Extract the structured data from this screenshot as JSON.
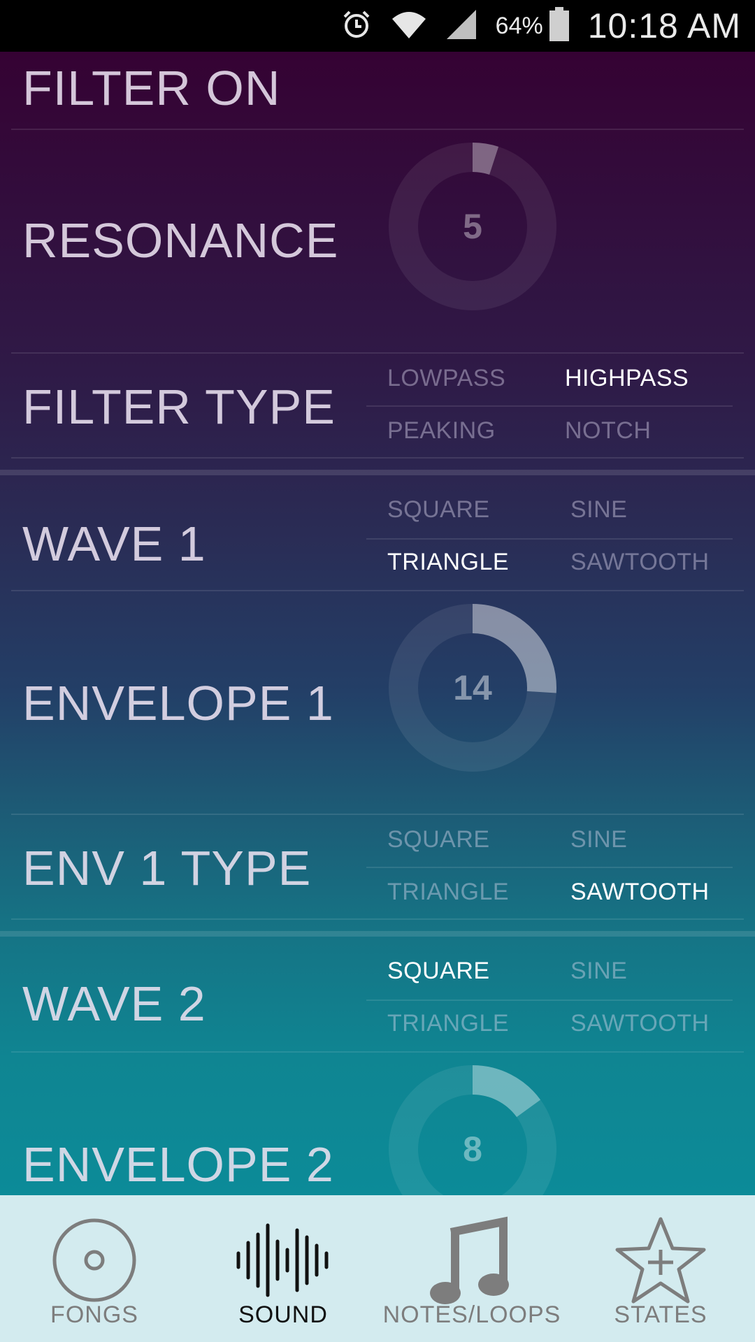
{
  "status_bar": {
    "battery_percent": "64%",
    "time": "10:18 AM",
    "icons": [
      "alarm-icon",
      "wifi-icon",
      "signal-icon",
      "battery-icon"
    ]
  },
  "rows": {
    "filter_on": {
      "label": "FILTER ON"
    },
    "resonance": {
      "label": "RESONANCE",
      "value": "5",
      "fraction": 0.05
    },
    "filter_type": {
      "label": "FILTER TYPE",
      "options": [
        "LOWPASS",
        "HIGHPASS",
        "PEAKING",
        "NOTCH"
      ],
      "selected": "HIGHPASS"
    },
    "wave1": {
      "label": "WAVE 1",
      "options": [
        "SQUARE",
        "SINE",
        "TRIANGLE",
        "SAWTOOTH"
      ],
      "selected": "TRIANGLE"
    },
    "envelope1": {
      "label": "ENVELOPE 1",
      "value": "14",
      "fraction": 0.26
    },
    "env1_type": {
      "label": "ENV 1 TYPE",
      "options": [
        "SQUARE",
        "SINE",
        "TRIANGLE",
        "SAWTOOTH"
      ],
      "selected": "SAWTOOTH"
    },
    "wave2": {
      "label": "WAVE 2",
      "options": [
        "SQUARE",
        "SINE",
        "TRIANGLE",
        "SAWTOOTH"
      ],
      "selected": "SQUARE"
    },
    "envelope2": {
      "label": "ENVELOPE 2",
      "value": "8",
      "fraction": 0.15
    }
  },
  "nav": {
    "items": [
      {
        "label": "FONGS",
        "icon": "disc-icon",
        "active": false
      },
      {
        "label": "SOUND",
        "icon": "waveform-icon",
        "active": true
      },
      {
        "label": "NOTES/LOOPS",
        "icon": "music-note-icon",
        "active": false
      },
      {
        "label": "STATES",
        "icon": "star-plus-icon",
        "active": false
      }
    ]
  }
}
